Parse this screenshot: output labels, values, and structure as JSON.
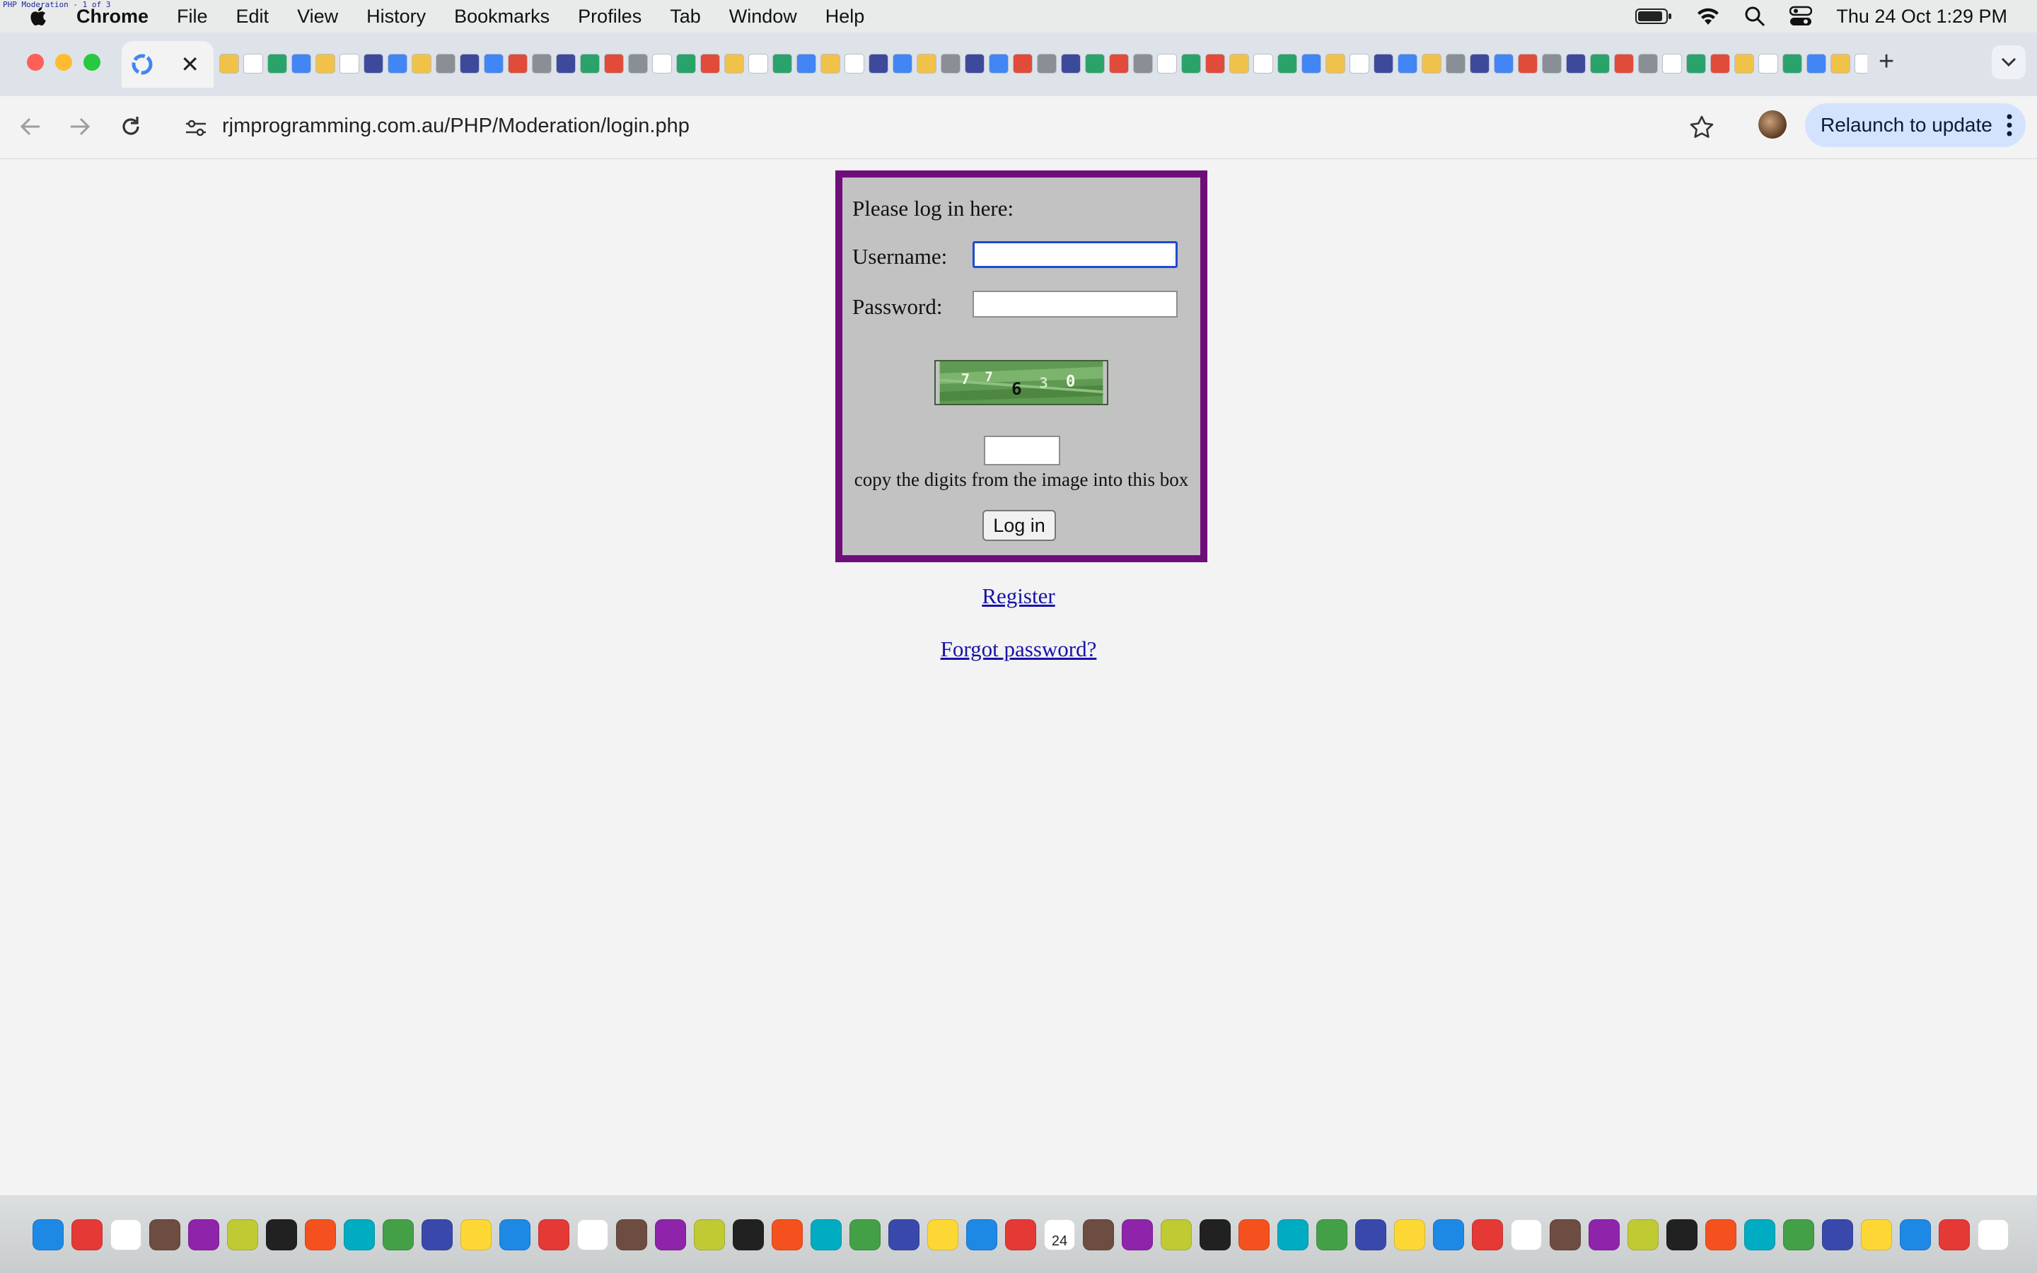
{
  "menubar": {
    "app_name": "Chrome",
    "items": [
      "File",
      "Edit",
      "View",
      "History",
      "Bookmarks",
      "Profiles",
      "Tab",
      "Window",
      "Help"
    ],
    "tiny_caption": "PHP Moderation - 1 of 3",
    "clock": "Thu 24 Oct  1:29 PM",
    "system_icons": [
      "battery-icon",
      "wifi-icon",
      "spotlight-search-icon",
      "control-center-icon"
    ]
  },
  "tabs": {
    "active_tab_favicon": "google-favicon",
    "close_symbol": "✕",
    "new_tab_symbol": "+",
    "background_tab_count": 120
  },
  "toolbar": {
    "url": "rjmprogramming.com.au/PHP/Moderation/login.php",
    "relaunch_label": "Relaunch to update"
  },
  "login": {
    "heading": "Please log in here:",
    "username_label": "Username:",
    "username_value": "",
    "password_label": "Password:",
    "password_value": "",
    "captcha_digits": "77630",
    "captcha_value": "",
    "captcha_hint": "copy the digits from the image into this box",
    "submit_label": "Log in"
  },
  "links": {
    "register": "Register",
    "forgot_password": "Forgot password?"
  },
  "colors": {
    "login_border": "#6f0e7a",
    "login_background": "#c2c2c2",
    "link": "#1a12a8",
    "relaunch_button": "#d3e3fd",
    "focus_ring": "#1e4bd0"
  },
  "dock": {
    "app_count": 56,
    "calendar_day": "24"
  }
}
